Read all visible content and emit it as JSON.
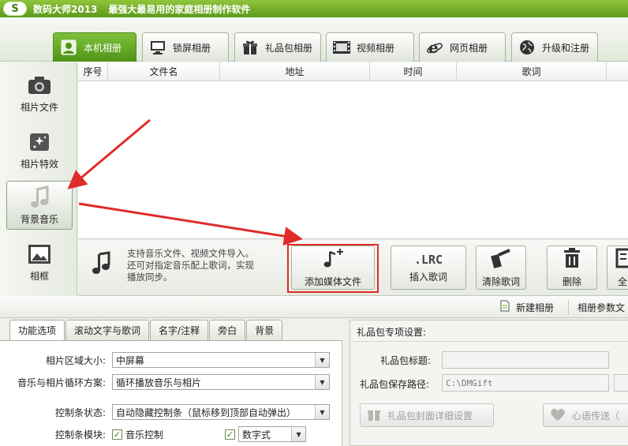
{
  "app": {
    "title": "数码大师2013",
    "slogan": "最强大最易用的家庭相册制作软件",
    "logo_letter": "S"
  },
  "main_tabs": [
    {
      "label": "本机相册",
      "icon": "person-photo-icon",
      "active": true
    },
    {
      "label": "锁屏相册",
      "icon": "monitor-icon",
      "active": false
    },
    {
      "label": "礼品包相册",
      "icon": "gift-icon",
      "active": false
    },
    {
      "label": "视频相册",
      "icon": "film-icon",
      "active": false
    },
    {
      "label": "网页相册",
      "icon": "ie-browser-icon",
      "active": false
    },
    {
      "label": "升级和注册",
      "icon": "globe-icon",
      "active": false
    }
  ],
  "sidebar": {
    "items": [
      {
        "label": "相片文件",
        "icon": "camera-icon",
        "active": false
      },
      {
        "label": "相片特效",
        "icon": "sparkle-effects-icon",
        "active": false
      },
      {
        "label": "背景音乐",
        "icon": "music-note-icon",
        "active": true
      },
      {
        "label": "相框",
        "icon": "picture-frame-icon",
        "active": false
      }
    ]
  },
  "table": {
    "columns": [
      "序号",
      "文件名",
      "地址",
      "时间",
      "歌词"
    ]
  },
  "action_panel": {
    "info_lines": [
      "支持音乐文件、视频文件导入。",
      "还可对指定音乐配上歌词，实现",
      "播放同步。"
    ],
    "buttons": [
      {
        "label": "添加媒体文件",
        "icon": "add-music-icon"
      },
      {
        "label": "插入歌词",
        "icon": "lrc-icon",
        "icon_text": ".LRC"
      },
      {
        "label": "清除歌词",
        "icon": "eraser-icon"
      },
      {
        "label": "删除",
        "icon": "trash-icon"
      },
      {
        "label": "全",
        "icon": "select-all-icon"
      }
    ]
  },
  "toolstrip": {
    "new_album": "新建相册",
    "album_params": "相册参数文"
  },
  "bottom_tabs": [
    "功能选项",
    "滚动文字与歌词",
    "名字/注释",
    "旁白",
    "背景"
  ],
  "form": {
    "photo_area_label": "相片区域大小:",
    "photo_area_value": "中屏幕",
    "loop_label": "音乐与相片循环方案:",
    "loop_value": "循环播放音乐与相片",
    "control_state_label": "控制条状态:",
    "control_state_value": "自动隐藏控制条（鼠标移到顶部自动弹出）",
    "control_module_label": "控制条模块:",
    "music_control_label": "音乐控制",
    "digit_style_value": "数字式"
  },
  "gift": {
    "title": "礼品包专项设置:",
    "pkg_title_label": "礼品包标题:",
    "pkg_title_value": "",
    "save_path_label": "礼品包保存路径:",
    "save_path_value": "C:\\DMGift",
    "cover_btn": "礼品包封面详细设置",
    "heart_btn": "心语传送（"
  },
  "colors": {
    "titlebar_green": "#6aa823",
    "highlight_red": "#e02b2b"
  }
}
